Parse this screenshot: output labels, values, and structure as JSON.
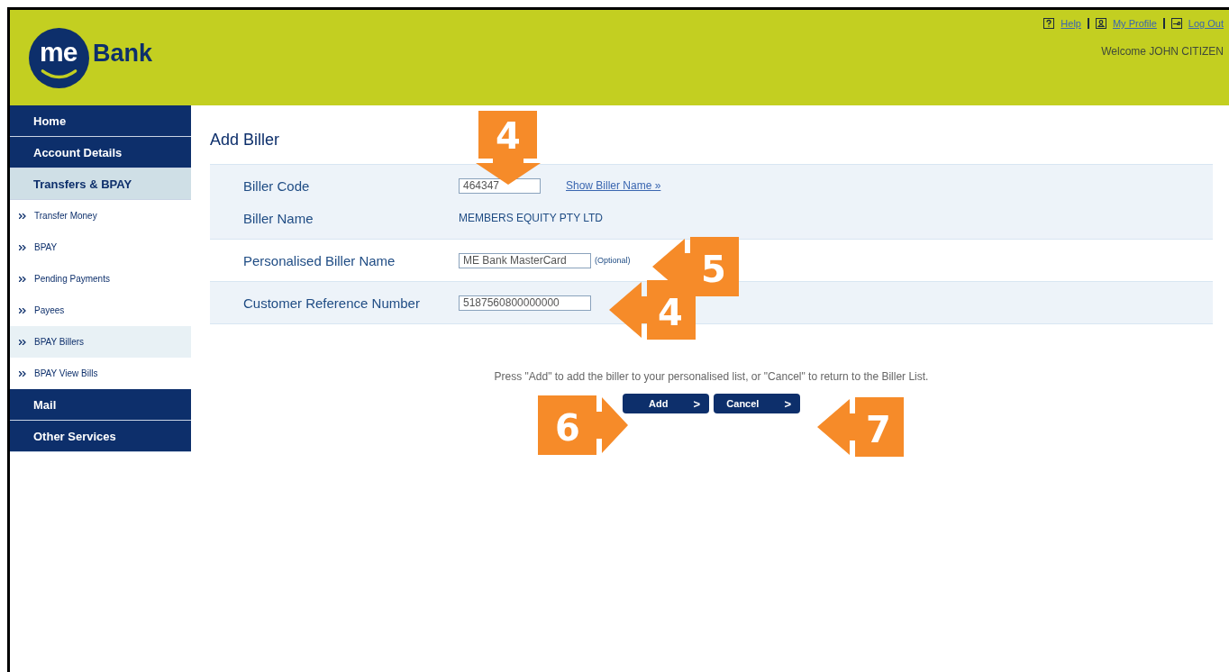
{
  "logo": {
    "mark": "me",
    "name": "Bank"
  },
  "top_links": [
    {
      "label": "Help",
      "kind": "help"
    },
    {
      "label": "My Profile",
      "kind": "profile"
    },
    {
      "label": "Log Out",
      "kind": "key"
    }
  ],
  "welcome": "Welcome JOHN CITIZEN",
  "sidebar": {
    "items": [
      {
        "label": "Home",
        "kind": "section",
        "selected": false
      },
      {
        "label": "Account Details",
        "kind": "section",
        "selected": false
      },
      {
        "label": "Transfers & BPAY",
        "kind": "section",
        "selected": true
      },
      {
        "label": "Transfer Money",
        "kind": "sub",
        "selected": false
      },
      {
        "label": "BPAY",
        "kind": "sub",
        "selected": false
      },
      {
        "label": "Pending Payments",
        "kind": "sub",
        "selected": false
      },
      {
        "label": "Payees",
        "kind": "sub",
        "selected": false
      },
      {
        "label": "BPAY Billers",
        "kind": "sub",
        "selected": true
      },
      {
        "label": "BPAY View Bills",
        "kind": "sub",
        "selected": false
      },
      {
        "label": "Mail",
        "kind": "section",
        "selected": false
      },
      {
        "label": "Other Services",
        "kind": "section",
        "selected": false
      }
    ]
  },
  "form": {
    "title": "Add Biller",
    "groups": [
      {
        "shaded": true,
        "rows": [
          {
            "label": "Biller Code",
            "kind": "input",
            "value": "464347",
            "link": "Show Biller Name »"
          },
          {
            "label": "Biller Name",
            "kind": "text",
            "value": "MEMBERS EQUITY PTY LTD"
          }
        ]
      },
      {
        "shaded": false,
        "rows": [
          {
            "label": "Personalised Biller Name",
            "kind": "input",
            "value": "ME Bank MasterCard",
            "note": "(Optional)"
          }
        ]
      },
      {
        "shaded": true,
        "rows": [
          {
            "label": "Customer Reference Number",
            "kind": "input",
            "value": "5187560800000000"
          }
        ]
      }
    ]
  },
  "instruction": "Press \"Add\" to add the biller to your personalised list, or \"Cancel\" to return to the Biller List.",
  "buttons": [
    {
      "label": "Add",
      "arrow": ">"
    },
    {
      "label": "Cancel",
      "arrow": ">"
    }
  ],
  "callouts": [
    {
      "number": "4",
      "kind": "down"
    },
    {
      "number": "5",
      "kind": "left"
    },
    {
      "number": "4",
      "kind": "left"
    },
    {
      "number": "6",
      "kind": "right"
    },
    {
      "number": "7",
      "kind": "left"
    }
  ]
}
